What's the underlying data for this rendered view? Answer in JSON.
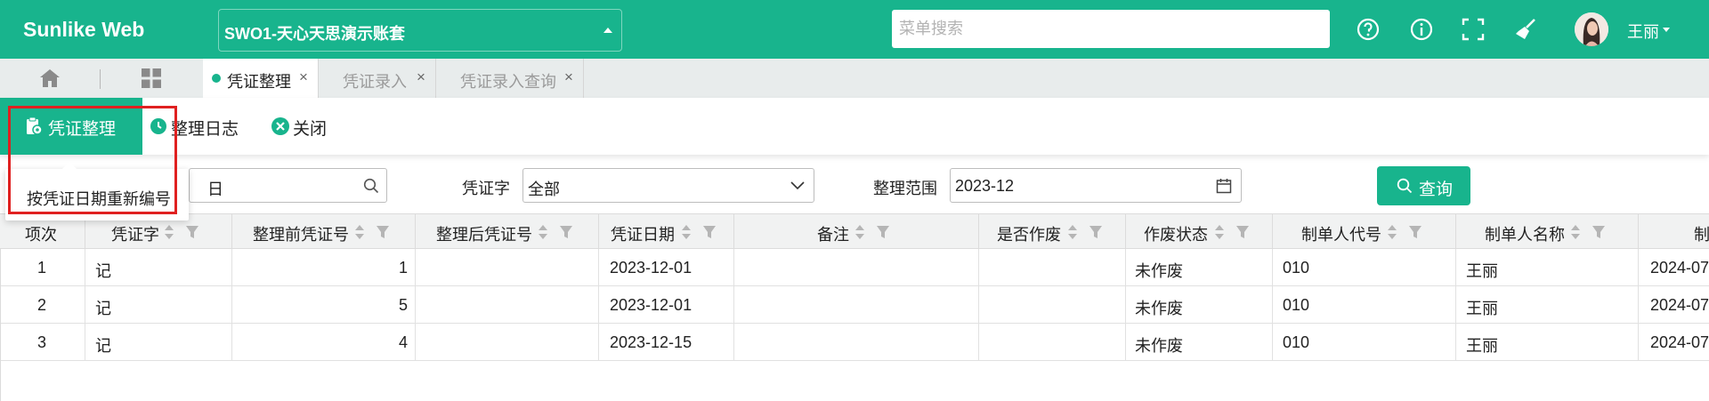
{
  "app": {
    "logo": "Sunlike Web",
    "account": "SWO1-天心天思演示账套",
    "search_placeholder": "菜单搜索",
    "username": "王丽",
    "brand_color": "#18b48d"
  },
  "tabs": [
    {
      "label": "凭证整理",
      "active": true
    },
    {
      "label": "凭证录入",
      "active": false
    },
    {
      "label": "凭证录入查询",
      "active": false
    }
  ],
  "toolbar": {
    "reorganize": "凭证整理",
    "log": "整理日志",
    "close": "关闭"
  },
  "dropdown": {
    "item": "按凭证日期重新编号"
  },
  "filters": {
    "date_fragment": "日",
    "voucher_type_label": "凭证字",
    "voucher_type_value": "全部",
    "range_label": "整理范围",
    "range_value": "2023-12",
    "query_button": "查询"
  },
  "table": {
    "columns": [
      "项次",
      "凭证字",
      "整理前凭证号",
      "整理后凭证号",
      "凭证日期",
      "备注",
      "是否作废",
      "作废状态",
      "制单人代号",
      "制单人名称",
      "制"
    ],
    "rows": [
      {
        "no": "1",
        "type": "记",
        "before": "1",
        "after": "",
        "date": "2023-12-01",
        "note": "",
        "void": "",
        "void_status": "未作废",
        "maker_code": "010",
        "maker_name": "王丽",
        "made_date": "2024-07"
      },
      {
        "no": "2",
        "type": "记",
        "before": "5",
        "after": "",
        "date": "2023-12-01",
        "note": "",
        "void": "",
        "void_status": "未作废",
        "maker_code": "010",
        "maker_name": "王丽",
        "made_date": "2024-07"
      },
      {
        "no": "3",
        "type": "记",
        "before": "4",
        "after": "",
        "date": "2023-12-15",
        "note": "",
        "void": "",
        "void_status": "未作废",
        "maker_code": "010",
        "maker_name": "王丽",
        "made_date": "2024-07"
      }
    ]
  }
}
